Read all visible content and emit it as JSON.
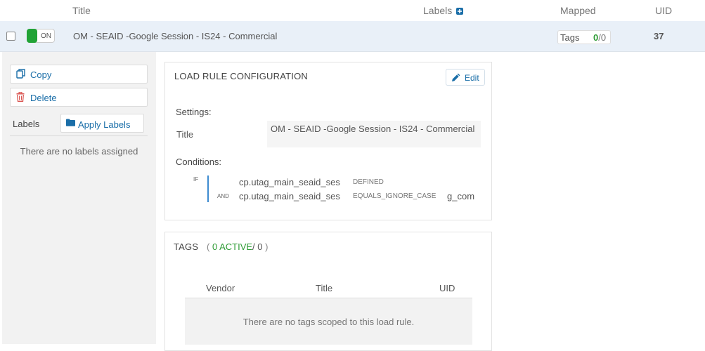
{
  "header": {
    "title": "Title",
    "labels": "Labels",
    "mapped": "Mapped",
    "uid": "UID"
  },
  "row": {
    "toggle_label": "ON",
    "title": "OM - SEAID -Google Session - IS24 - Commercial",
    "tags_label": "Tags",
    "tags_active": "0",
    "tags_sep": "/",
    "tags_total": "0",
    "uid": "37"
  },
  "sidebar": {
    "copy": "Copy",
    "delete": "Delete",
    "labels_title": "Labels",
    "apply_labels": "Apply Labels",
    "no_labels": "There are no labels assigned"
  },
  "config": {
    "title": "LOAD RULE CONFIGURATION",
    "edit": "Edit",
    "settings": "Settings:",
    "title_label": "Title",
    "title_value": "OM - SEAID -Google Session - IS24 - Commercial",
    "conditions": "Conditions:",
    "if_kw": "IF",
    "and_kw": "AND",
    "cond1": {
      "variable": "cp.utag_main_seaid_ses",
      "operator": "DEFINED",
      "value": ""
    },
    "cond2": {
      "variable": "cp.utag_main_seaid_ses",
      "operator": "EQUALS_IGNORE_CASE",
      "value": "g_com"
    }
  },
  "tags": {
    "title": "TAGS",
    "open_paren": "(",
    "active": "0 ACTIVE",
    "sep": "/",
    "total": "0",
    "close_paren": ")",
    "columns": [
      "Vendor",
      "Title",
      "UID"
    ],
    "empty": "There are no tags scoped to this load rule."
  },
  "colors": {
    "accent": "#1a6ea8",
    "on_green": "#21a336",
    "active_green": "#2d9b34",
    "row_highlight": "#e9f0f8"
  }
}
